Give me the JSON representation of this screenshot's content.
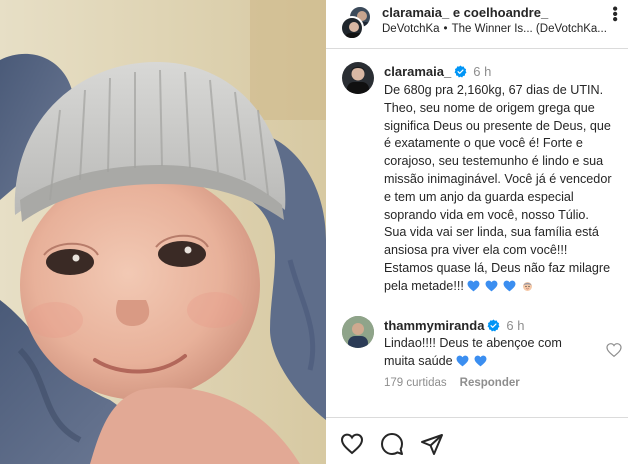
{
  "header": {
    "title": "claramaia_ e coelhoandre_",
    "audio_artist": "DeVotchKa",
    "audio_separator": "•",
    "audio_track": "The Winner Is... (DeVotchKa..."
  },
  "caption": {
    "username": "claramaia_",
    "time": "6 h",
    "lines": [
      "De 680g pra 2,160kg, 67 dias de UTIN.",
      "Theo, seu nome de origem grega que",
      "significa Deus ou presente de Deus, que",
      "é exatamente o que você é! Forte e",
      "corajoso, seu testemunho é lindo e sua",
      "missão inimaginável. Você já é vencedor",
      "e tem um anjo da guarda especial",
      "soprando vida em você, nosso Túlio.",
      "Sua vida vai ser linda, sua família está",
      "ansiosa pra viver ela com você!!!",
      "Estamos quase lá, Deus não faz milagre",
      "pela metade!!!"
    ]
  },
  "comment": {
    "username": "thammymiranda",
    "time": "6 h",
    "lines": [
      "Lindao!!!! Deus te abençoe com",
      "muita saúde"
    ],
    "likes": "179 curtidas",
    "reply_label": "Responder"
  },
  "colors": {
    "text": "#262626",
    "muted": "#8e8e8e",
    "verified": "#0095f6",
    "divider": "#dbdbdb",
    "blue_heart": "#3b8ef0"
  }
}
